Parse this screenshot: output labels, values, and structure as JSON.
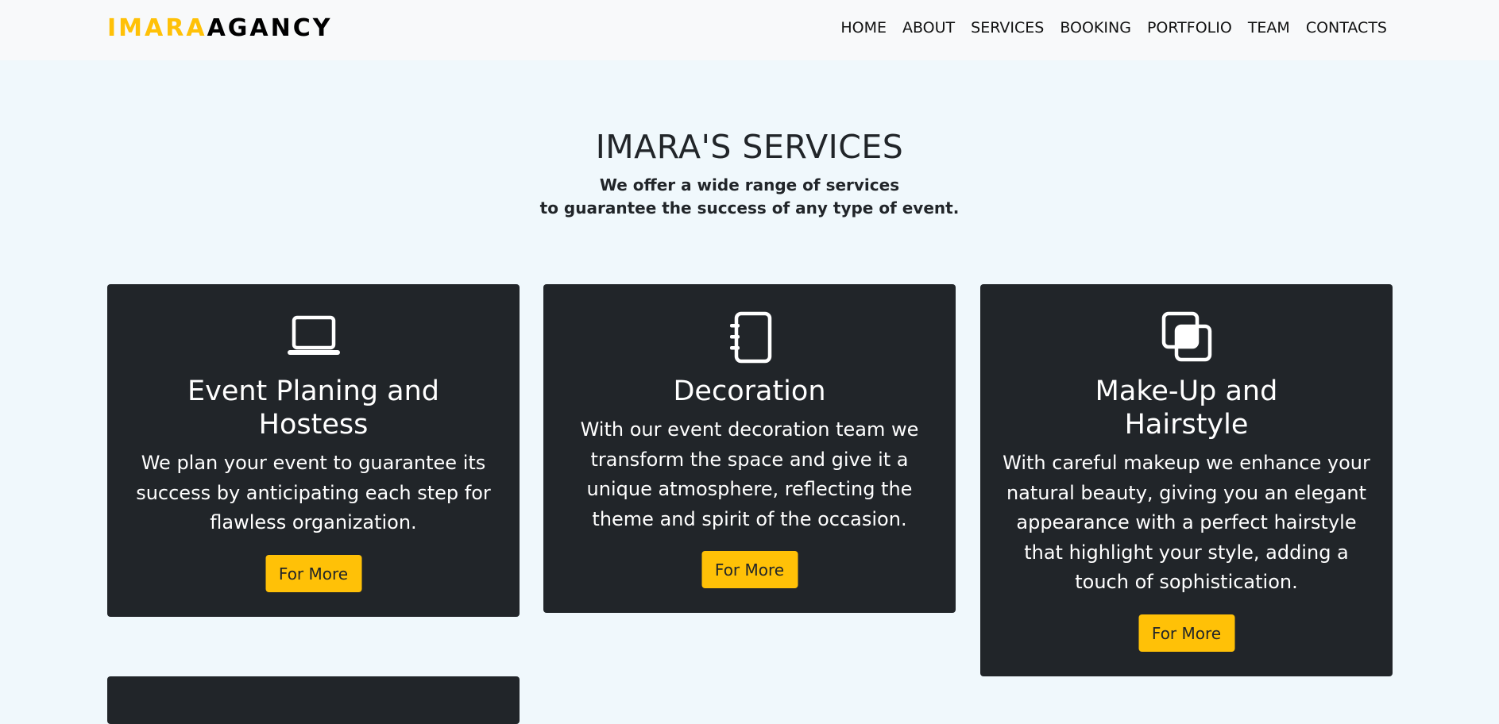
{
  "navbar": {
    "brand_part1": "IMARA",
    "brand_part2": "AGANCY",
    "links": [
      "HOME",
      "ABOUT",
      "SERVICES",
      "BOOKING",
      "PORTFOLIO",
      "TEAM",
      "CONTACTS"
    ]
  },
  "services": {
    "title": "IMARA'S SERVICES",
    "subtitle_line1": "We offer a wide range of services",
    "subtitle_line2": "to guarantee the success of any type of event.",
    "cards": [
      {
        "icon": "laptop-icon",
        "title": "Event Planing and Hostess",
        "text": "We plan your event to guarantee its success by anticipating each step for flawless organization.",
        "button": "For More"
      },
      {
        "icon": "notebook-icon",
        "title": "Decoration",
        "text": "With our event decoration team we transform the space and give it a unique atmosphere, reflecting the theme and spirit of the occasion.",
        "button": "For More"
      },
      {
        "icon": "layers-icon",
        "title": "Make-Up and Hairstyle",
        "text": "With careful makeup we enhance your natural beauty, giving you an elegant appearance with a perfect hairstyle that highlight your style, adding a touch of sophistication.",
        "button": "For More"
      }
    ]
  },
  "colors": {
    "accent": "#ffc107",
    "card_bg": "#212529",
    "page_bg": "#f0f8fc",
    "nav_bg": "#f8f9fa"
  }
}
